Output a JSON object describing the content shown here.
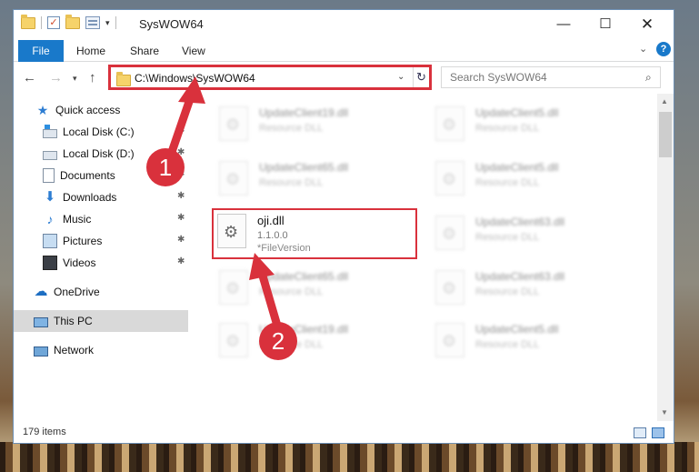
{
  "window": {
    "title": "SysWOW64",
    "controls": {
      "minimize": "—",
      "maximize": "☐",
      "close": "✕"
    }
  },
  "ribbon": {
    "tabs": [
      "File",
      "Home",
      "Share",
      "View"
    ],
    "help": "?"
  },
  "navigation": {
    "address": "C:\\Windows\\SysWOW64",
    "search_placeholder": "Search SysWOW64"
  },
  "sidebar": {
    "items": [
      {
        "label": "Quick access",
        "icon": "star-icon"
      },
      {
        "label": "Local Disk (C:)",
        "icon": "drive-icon",
        "pinned": true
      },
      {
        "label": "Local Disk (D:)",
        "icon": "drive-icon",
        "pinned": true
      },
      {
        "label": "Documents",
        "icon": "documents-icon",
        "pinned": true
      },
      {
        "label": "Downloads",
        "icon": "downloads-icon",
        "pinned": true
      },
      {
        "label": "Music",
        "icon": "music-icon",
        "pinned": true
      },
      {
        "label": "Pictures",
        "icon": "pictures-icon",
        "pinned": true
      },
      {
        "label": "Videos",
        "icon": "videos-icon",
        "pinned": true
      },
      {
        "label": "OneDrive",
        "icon": "onedrive-icon"
      },
      {
        "label": "This PC",
        "icon": "this-pc-icon",
        "selected": true
      },
      {
        "label": "Network",
        "icon": "network-icon"
      }
    ]
  },
  "files": {
    "left_column": [
      {
        "name": "UpdateClient19.dll",
        "type": "Resource DLL"
      },
      {
        "name": "UpdateClient65.dll",
        "type": "Resource DLL"
      },
      {
        "name": "oji.dll",
        "version": "1.1.0.0",
        "type": "*FileVersion",
        "highlighted": true
      },
      {
        "name": "UpdateClient65.dll",
        "type": "Resource DLL"
      },
      {
        "name": "UpdateClient19.dll",
        "type": "Resource DLL"
      }
    ],
    "right_column": [
      {
        "name": "UpdateClient5.dll",
        "type": "Resource DLL"
      },
      {
        "name": "UpdateClient5.dll",
        "type": "Resource DLL"
      },
      {
        "name": "UpdateClient63.dll",
        "type": "Resource DLL"
      },
      {
        "name": "UpdateClient63.dll",
        "type": "Resource DLL"
      },
      {
        "name": "UpdateClient5.dll",
        "type": "Resource DLL"
      }
    ]
  },
  "status": {
    "item_count": "179 items"
  },
  "annotations": {
    "step1": "1",
    "step2": "2",
    "color": "#d9313c"
  }
}
